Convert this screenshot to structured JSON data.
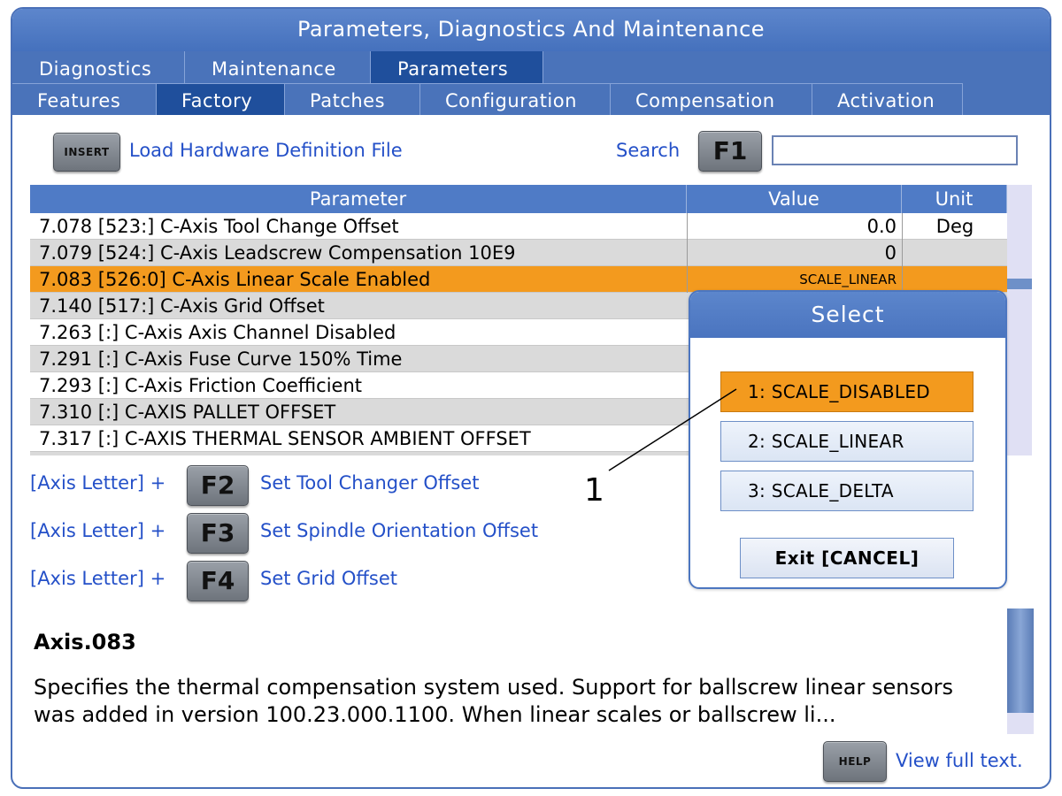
{
  "window": {
    "title": "Parameters, Diagnostics And Maintenance"
  },
  "tabs_row1": [
    {
      "label": "Diagnostics",
      "active": false
    },
    {
      "label": "Maintenance",
      "active": false
    },
    {
      "label": "Parameters",
      "active": true
    }
  ],
  "tabs_row2": [
    {
      "label": "Features",
      "active": false
    },
    {
      "label": "Factory",
      "active": true
    },
    {
      "label": "Patches",
      "active": false
    },
    {
      "label": "Configuration",
      "active": false
    },
    {
      "label": "Compensation",
      "active": false
    },
    {
      "label": "Activation",
      "active": false
    }
  ],
  "toolbar": {
    "insert_key": "INSERT",
    "load_hw_label": "Load Hardware Definition File",
    "search_label": "Search",
    "f1_key": "F1",
    "search_value": ""
  },
  "table": {
    "headers": {
      "parameter": "Parameter",
      "value": "Value",
      "unit": "Unit"
    },
    "rows": [
      {
        "param": "7.078 [523:] C-Axis Tool Change Offset",
        "value": "0.0",
        "unit": "Deg"
      },
      {
        "param": "7.079 [524:] C-Axis Leadscrew Compensation 10E9",
        "value": "0",
        "unit": ""
      },
      {
        "param": "7.083 [526:0] C-Axis Linear Scale Enabled",
        "value": "SCALE_LINEAR",
        "unit": ""
      },
      {
        "param": "7.140 [517:] C-Axis Grid Offset",
        "value": "",
        "unit": ""
      },
      {
        "param": "7.263 [:] C-Axis Axis Channel Disabled",
        "value": "",
        "unit": ""
      },
      {
        "param": "7.291 [:] C-Axis Fuse Curve 150% Time",
        "value": "",
        "unit": ""
      },
      {
        "param": "7.293 [:] C-Axis Friction Coefficient",
        "value": "",
        "unit": ""
      },
      {
        "param": "7.310 [:] C-AXIS PALLET OFFSET",
        "value": "",
        "unit": ""
      },
      {
        "param": "7.317 [:] C-AXIS THERMAL SENSOR AMBIENT OFFSET",
        "value": "",
        "unit": ""
      }
    ]
  },
  "shortcuts": [
    {
      "prefix": "[Axis Letter] +",
      "key": "F2",
      "label": "Set Tool Changer Offset"
    },
    {
      "prefix": "[Axis Letter] +",
      "key": "F3",
      "label": "Set Spindle Orientation Offset"
    },
    {
      "prefix": "[Axis Letter] +",
      "key": "F4",
      "label": "Set Grid Offset"
    }
  ],
  "dialog": {
    "title": "Select",
    "options": [
      {
        "label": "1: SCALE_DISABLED",
        "selected": true
      },
      {
        "label": "2: SCALE_LINEAR",
        "selected": false
      },
      {
        "label": "3: SCALE_DELTA",
        "selected": false
      }
    ],
    "exit_label": "Exit  [CANCEL]"
  },
  "description": {
    "title": "Axis.083",
    "body": "Specifies the thermal compensation system used. Support for ballscrew linear sensors was added in version 100.23.000.1100. When linear scales or ballscrew li..."
  },
  "footer": {
    "help_key": "HELP",
    "view_full": "View full text."
  },
  "annotation": {
    "label": "1"
  },
  "colors": {
    "header_blue": "#4a73ba",
    "active_tab": "#1f4f9c",
    "selected_orange": "#f39a1e",
    "link_blue": "#2450c8"
  }
}
